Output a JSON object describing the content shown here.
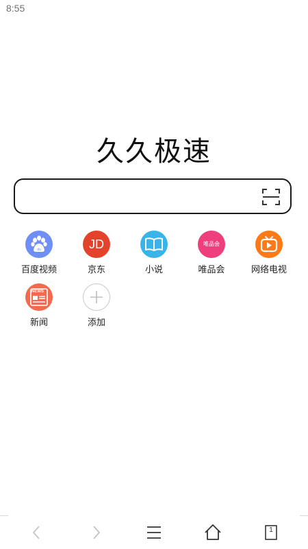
{
  "status_bar": {
    "time": "8:55"
  },
  "app": {
    "title": "久久极速"
  },
  "search": {
    "value": "",
    "scan_icon": "scan-icon"
  },
  "shortcuts": [
    {
      "label": "百度视频",
      "icon": "baidu-paw-icon",
      "color": "#6f8ef7"
    },
    {
      "label": "京东",
      "icon": "jd-logo-icon",
      "icon_text": "JD",
      "color": "#e4432b"
    },
    {
      "label": "小说",
      "icon": "open-book-icon",
      "color": "#3ab3e9"
    },
    {
      "label": "唯品会",
      "icon": "vip-logo-icon",
      "icon_text": "唯品会",
      "color": "#ef3e7c"
    },
    {
      "label": "网络电视",
      "icon": "tv-icon",
      "color": "#ff7a17"
    },
    {
      "label": "新闻",
      "icon": "newspaper-icon",
      "icon_text": "NEWS",
      "color": "#f26a4f"
    },
    {
      "label": "添加",
      "icon": "plus-icon",
      "color": "#c8c8c8"
    }
  ],
  "bottom_nav": {
    "back_icon": "chevron-left-icon",
    "forward_icon": "chevron-right-icon",
    "menu_icon": "hamburger-menu-icon",
    "home_icon": "home-icon",
    "tabs_icon": "tabs-icon",
    "tab_count": "1"
  }
}
